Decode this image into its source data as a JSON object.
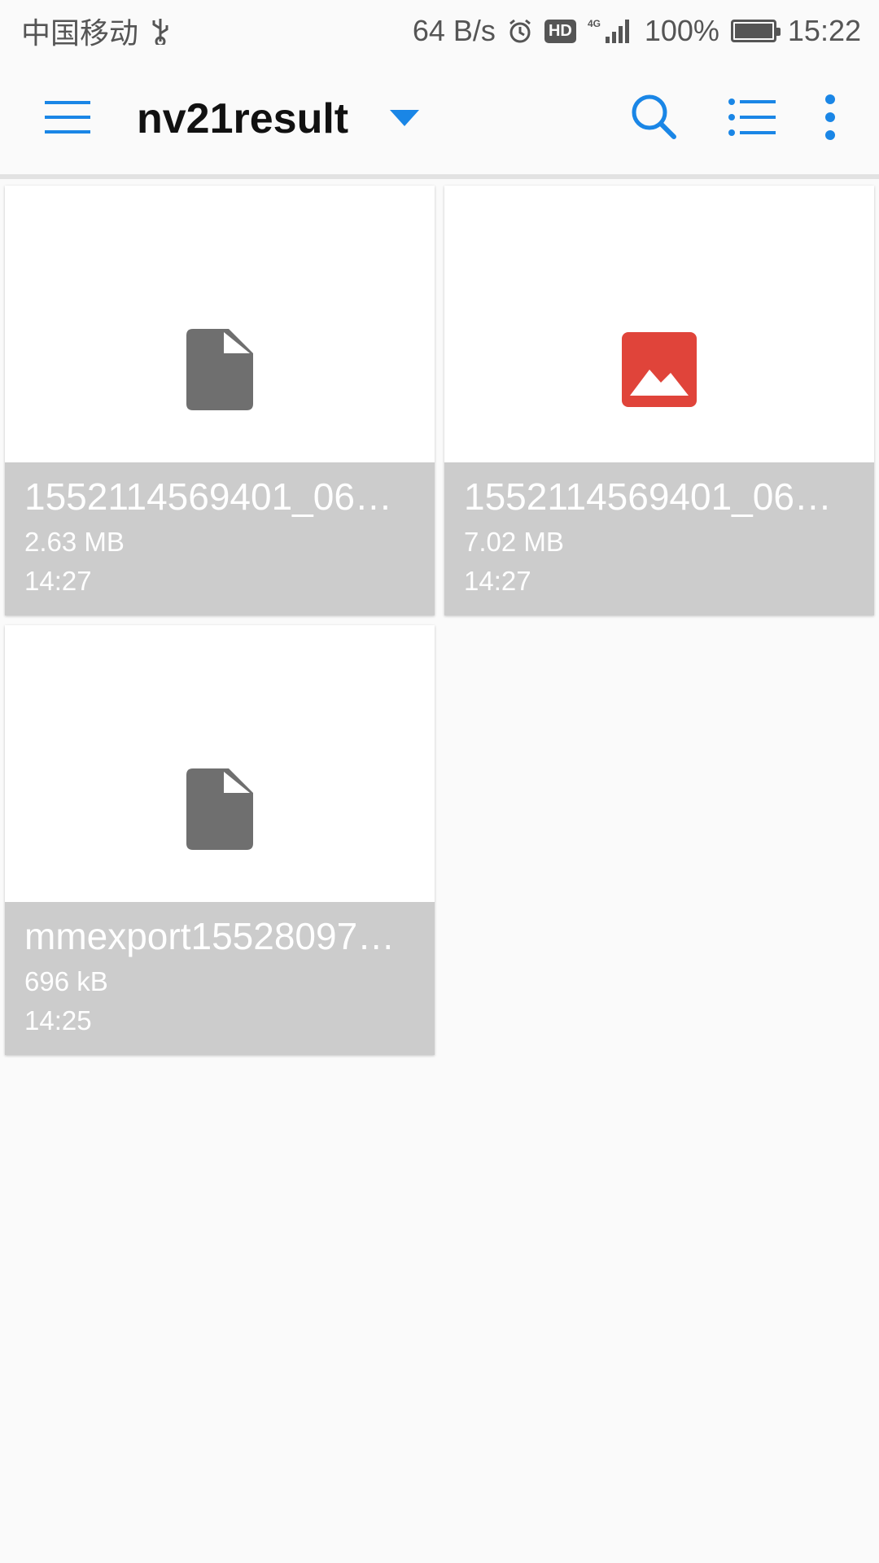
{
  "status_bar": {
    "carrier": "中国移动",
    "net_speed": "64 B/s",
    "hd_badge": "HD",
    "network": "4G",
    "battery": "100%",
    "time": "15:22"
  },
  "toolbar": {
    "title": "nv21result",
    "menu_icon": "hamburger-icon",
    "dropdown_icon": "triangle-down-icon",
    "search_icon": "search-icon",
    "list_icon": "list-view-icon",
    "more_icon": "overflow-icon"
  },
  "files": [
    {
      "name": "1552114569401_06…",
      "size": "2.63 MB",
      "time": "14:27",
      "type": "document-icon"
    },
    {
      "name": "1552114569401_06…",
      "size": "7.02 MB",
      "time": "14:27",
      "type": "image-icon"
    },
    {
      "name": "mmexport15528097…",
      "size": "696 kB",
      "time": "14:25",
      "type": "document-icon"
    }
  ],
  "colors": {
    "accent": "#1a86e6",
    "doc_icon": "#6f6f6f",
    "image_icon": "#e0443a",
    "info_bg": "#cccccc"
  }
}
